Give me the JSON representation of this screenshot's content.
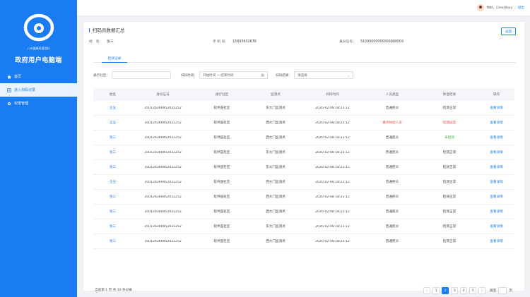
{
  "sidebar": {
    "org": "八州健康码管理局",
    "app_name": "政府用户电脑端",
    "items": [
      {
        "label": "首页",
        "icon": "home-icon"
      },
      {
        "label": "进入扫码记录",
        "icon": "list-icon"
      },
      {
        "label": "权限管理",
        "icon": "settings-icon"
      }
    ]
  },
  "topbar": {
    "user": "你好，ChenBoxy",
    "logout": "退出"
  },
  "page": {
    "title": "扫码员数据汇总",
    "back_label": "返回",
    "name_label": "姓　名：",
    "name_value": "张三",
    "phone_label": "手 机 号：",
    "phone_value": "15695632678",
    "id_label": "身份证号：",
    "id_value": "5100000000000000000X",
    "tab_label": "检测记录"
  },
  "filters": {
    "community_label": "通行社区：",
    "community_value": "",
    "time_label": "扫码时间：",
    "time_placeholder": "开始时间 ~ 结束时间",
    "result_label": "扫码结果：",
    "result_value": "请选择"
  },
  "table": {
    "headers": [
      "姓名",
      "身份证号",
      "通行社区",
      "监测点",
      "扫码时间",
      "人员类型",
      "体温结果",
      "操作"
    ],
    "rows": [
      {
        "name": "王五",
        "id": "350126366952032252",
        "community": "软件园社区",
        "checkpoint": "东大门监测点",
        "time": "2020-02-08 18:23:12",
        "type": "普通民众",
        "temp": "检测正常",
        "action": "查看详情"
      },
      {
        "name": "王五",
        "id": "350126366952032252",
        "community": "软件园社区",
        "checkpoint": "西大门监测点",
        "time": "2020-02-08 18:23:12",
        "type": "重点防控人员",
        "temp": "检测异常",
        "action": "查看详情"
      },
      {
        "name": "张三",
        "id": "350126366952032252",
        "community": "软件园社区",
        "checkpoint": "西大门监测点",
        "time": "2020-02-08 18:23:12",
        "type": "普通民众",
        "temp": "未检测",
        "action": "查看详情"
      },
      {
        "name": "张三",
        "id": "350126366952032252",
        "community": "软件园社区",
        "checkpoint": "东大门监测点",
        "time": "2020-02-08 18:23:12",
        "type": "普通民众",
        "temp": "检测正常",
        "action": "查看详情"
      },
      {
        "name": "张三",
        "id": "350126366952032252",
        "community": "软件园社区",
        "checkpoint": "东大门监测点",
        "time": "2020-02-08 18:23:12",
        "type": "普通民众",
        "temp": "检测正常",
        "action": "查看详情"
      },
      {
        "name": "王五",
        "id": "350126366952032252",
        "community": "软件园社区",
        "checkpoint": "西大门监测点",
        "time": "2020-02-08 18:23:12",
        "type": "普通民众",
        "temp": "检测正常",
        "action": "查看详情"
      },
      {
        "name": "张三",
        "id": "350126366952032252",
        "community": "软件园社区",
        "checkpoint": "西大门监测点",
        "time": "2020-02-08 18:23:12",
        "type": "普通民众",
        "temp": "检测正常",
        "action": "查看详情"
      },
      {
        "name": "张三",
        "id": "350126366952032252",
        "community": "软件园社区",
        "checkpoint": "西大门监测点",
        "time": "2020-02-08 18:23:12",
        "type": "普通民众",
        "temp": "检测正常",
        "action": "查看详情"
      },
      {
        "name": "张三",
        "id": "350126366952032252",
        "community": "软件园社区",
        "checkpoint": "东大门监测点",
        "time": "2020-02-08 18:23:12",
        "type": "普通民众",
        "temp": "检测正常",
        "action": "查看详情"
      },
      {
        "name": "张三",
        "id": "350126366952032252",
        "community": "软件园社区",
        "checkpoint": "西大门监测点",
        "time": "2020-02-08 18:23:12",
        "type": "普通民众",
        "temp": "检测正常",
        "action": "查看详情"
      }
    ]
  },
  "pager": {
    "total": "当前第 1 页 共 10 条记录",
    "prev": "‹",
    "pages": [
      "1",
      "2",
      "3",
      "4",
      "5"
    ],
    "active_page": "2",
    "next": "›",
    "goto_label": "跳至",
    "goto_suffix": "页"
  },
  "colors": {
    "brand": "#1a7cf2",
    "alert": "#e84a4a",
    "ok": "#40b24a"
  }
}
